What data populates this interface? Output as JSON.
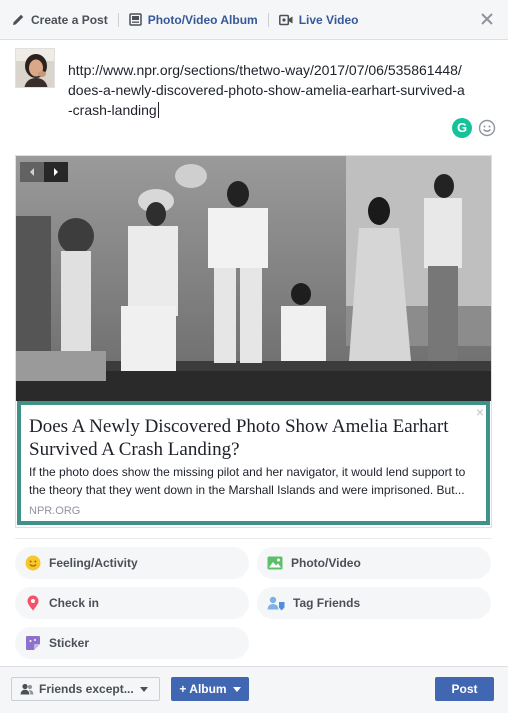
{
  "tabs": {
    "create_post": "Create a Post",
    "photo_album": "Photo/Video Album",
    "live_video": "Live Video"
  },
  "composer": {
    "text": "http://www.npr.org/sections/thetwo-way/2017/07/06/535861448/does-a-newly-discovered-photo-show-amelia-earhart-survived-a-crash-landing",
    "grammarly_letter": "G"
  },
  "preview": {
    "title": "Does A Newly Discovered Photo Show Amelia Earhart Survived A Crash Landing?",
    "description": "If the photo does show the missing pilot and her navigator, it would lend support to the theory that they went down in the Marshall Islands and were imprisoned. But...",
    "source": "NPR.ORG",
    "close_symbol": "×"
  },
  "actions": {
    "feeling": "Feeling/Activity",
    "photo_video": "Photo/Video",
    "check_in": "Check in",
    "tag_friends": "Tag Friends",
    "sticker": "Sticker"
  },
  "footer": {
    "privacy": "Friends except...",
    "album": "+ Album",
    "post": "Post"
  },
  "colors": {
    "brand_blue": "#4267b2",
    "link_blue": "#365899",
    "preview_border": "#41918b",
    "grammarly_green": "#15c39a"
  },
  "icons": [
    "pencil-icon",
    "album-icon",
    "video-camera-icon",
    "close-icon",
    "grammarly-icon",
    "emoji-icon",
    "arrow-left-icon",
    "arrow-right-icon",
    "smiley-icon",
    "photo-icon",
    "location-pin-icon",
    "tag-friends-icon",
    "sticker-icon",
    "friends-icon",
    "chevron-down-icon"
  ]
}
